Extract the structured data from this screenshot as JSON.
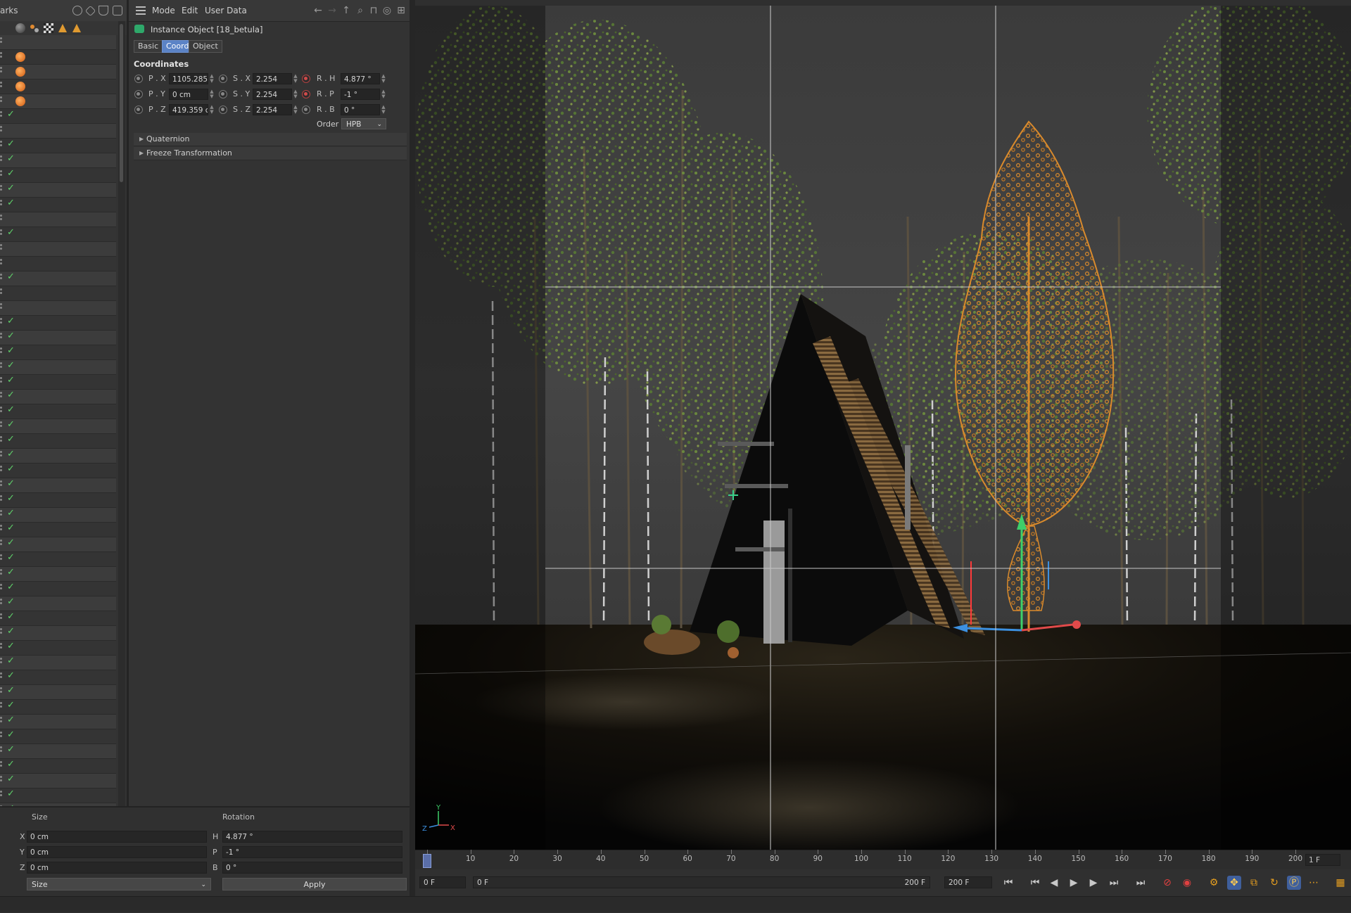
{
  "object_manager": {
    "title": "arks",
    "row_count": 55,
    "check_glyph": "✓",
    "ball_rows": [
      1,
      2,
      3,
      4
    ],
    "check_rows": [
      5,
      7,
      8,
      9,
      10,
      11,
      13,
      16,
      19,
      20,
      21,
      22,
      23,
      24,
      25,
      26,
      27,
      28,
      29,
      30,
      31,
      32,
      33,
      34,
      35,
      36,
      37,
      38,
      39,
      40,
      41,
      42,
      43,
      44,
      45,
      46,
      47,
      48,
      49,
      50,
      51,
      52,
      53,
      54
    ]
  },
  "attributes": {
    "menu": [
      "Mode",
      "Edit",
      "User Data"
    ],
    "object_title": "Instance Object [18_betula]",
    "tabs": [
      {
        "label": "Basic",
        "active": false
      },
      {
        "label": "Coord.",
        "active": true
      },
      {
        "label": "Object",
        "active": false
      }
    ],
    "section_title": "Coordinates",
    "position": {
      "px_label": "P . X",
      "px": "1105.285 c",
      "py_label": "P . Y",
      "py": "0 cm",
      "pz_label": "P . Z",
      "pz": "419.359 cr"
    },
    "scale": {
      "sx_label": "S . X",
      "sx": "2.254",
      "sy_label": "S . Y",
      "sy": "2.254",
      "sz_label": "S . Z",
      "sz": "2.254"
    },
    "rotation": {
      "rh_label": "R . H",
      "rh": "4.877 °",
      "rp_label": "R . P",
      "rp": "-1 °",
      "rb_label": "R . B",
      "rb": "0 °"
    },
    "order_label": "Order",
    "order_value": "HPB",
    "collapsed_sections": [
      "Quaternion",
      "Freeze Transformation"
    ]
  },
  "coordinate_manager": {
    "size_header": "Size",
    "rotation_header": "Rotation",
    "rows": [
      {
        "axis": "X",
        "size": "0 cm",
        "rot_axis": "H",
        "rot": "4.877 °"
      },
      {
        "axis": "Y",
        "size": "0 cm",
        "rot_axis": "P",
        "rot": "-1 °"
      },
      {
        "axis": "Z",
        "size": "0 cm",
        "rot_axis": "B",
        "rot": "0 °"
      }
    ],
    "mode_select": "Size",
    "apply_label": "Apply"
  },
  "viewport": {
    "axis_labels": {
      "y": "Y",
      "z": "Z",
      "x": "X"
    }
  },
  "timeline": {
    "ticks": [
      "0",
      "10",
      "20",
      "30",
      "40",
      "50",
      "60",
      "70",
      "80",
      "90",
      "100",
      "110",
      "120",
      "130",
      "140",
      "150",
      "160",
      "170",
      "180",
      "190",
      "200"
    ],
    "current_frame": "1 F"
  },
  "transport": {
    "start_frame": "0 F",
    "range_start": "0 F",
    "range_end": "200 F",
    "end_frame": "200 F"
  },
  "colors": {
    "selected_tree": "#d98a2c",
    "foliage": "#6a8a3c",
    "accent_tab": "#5b83c6",
    "check": "#5fd06a"
  }
}
